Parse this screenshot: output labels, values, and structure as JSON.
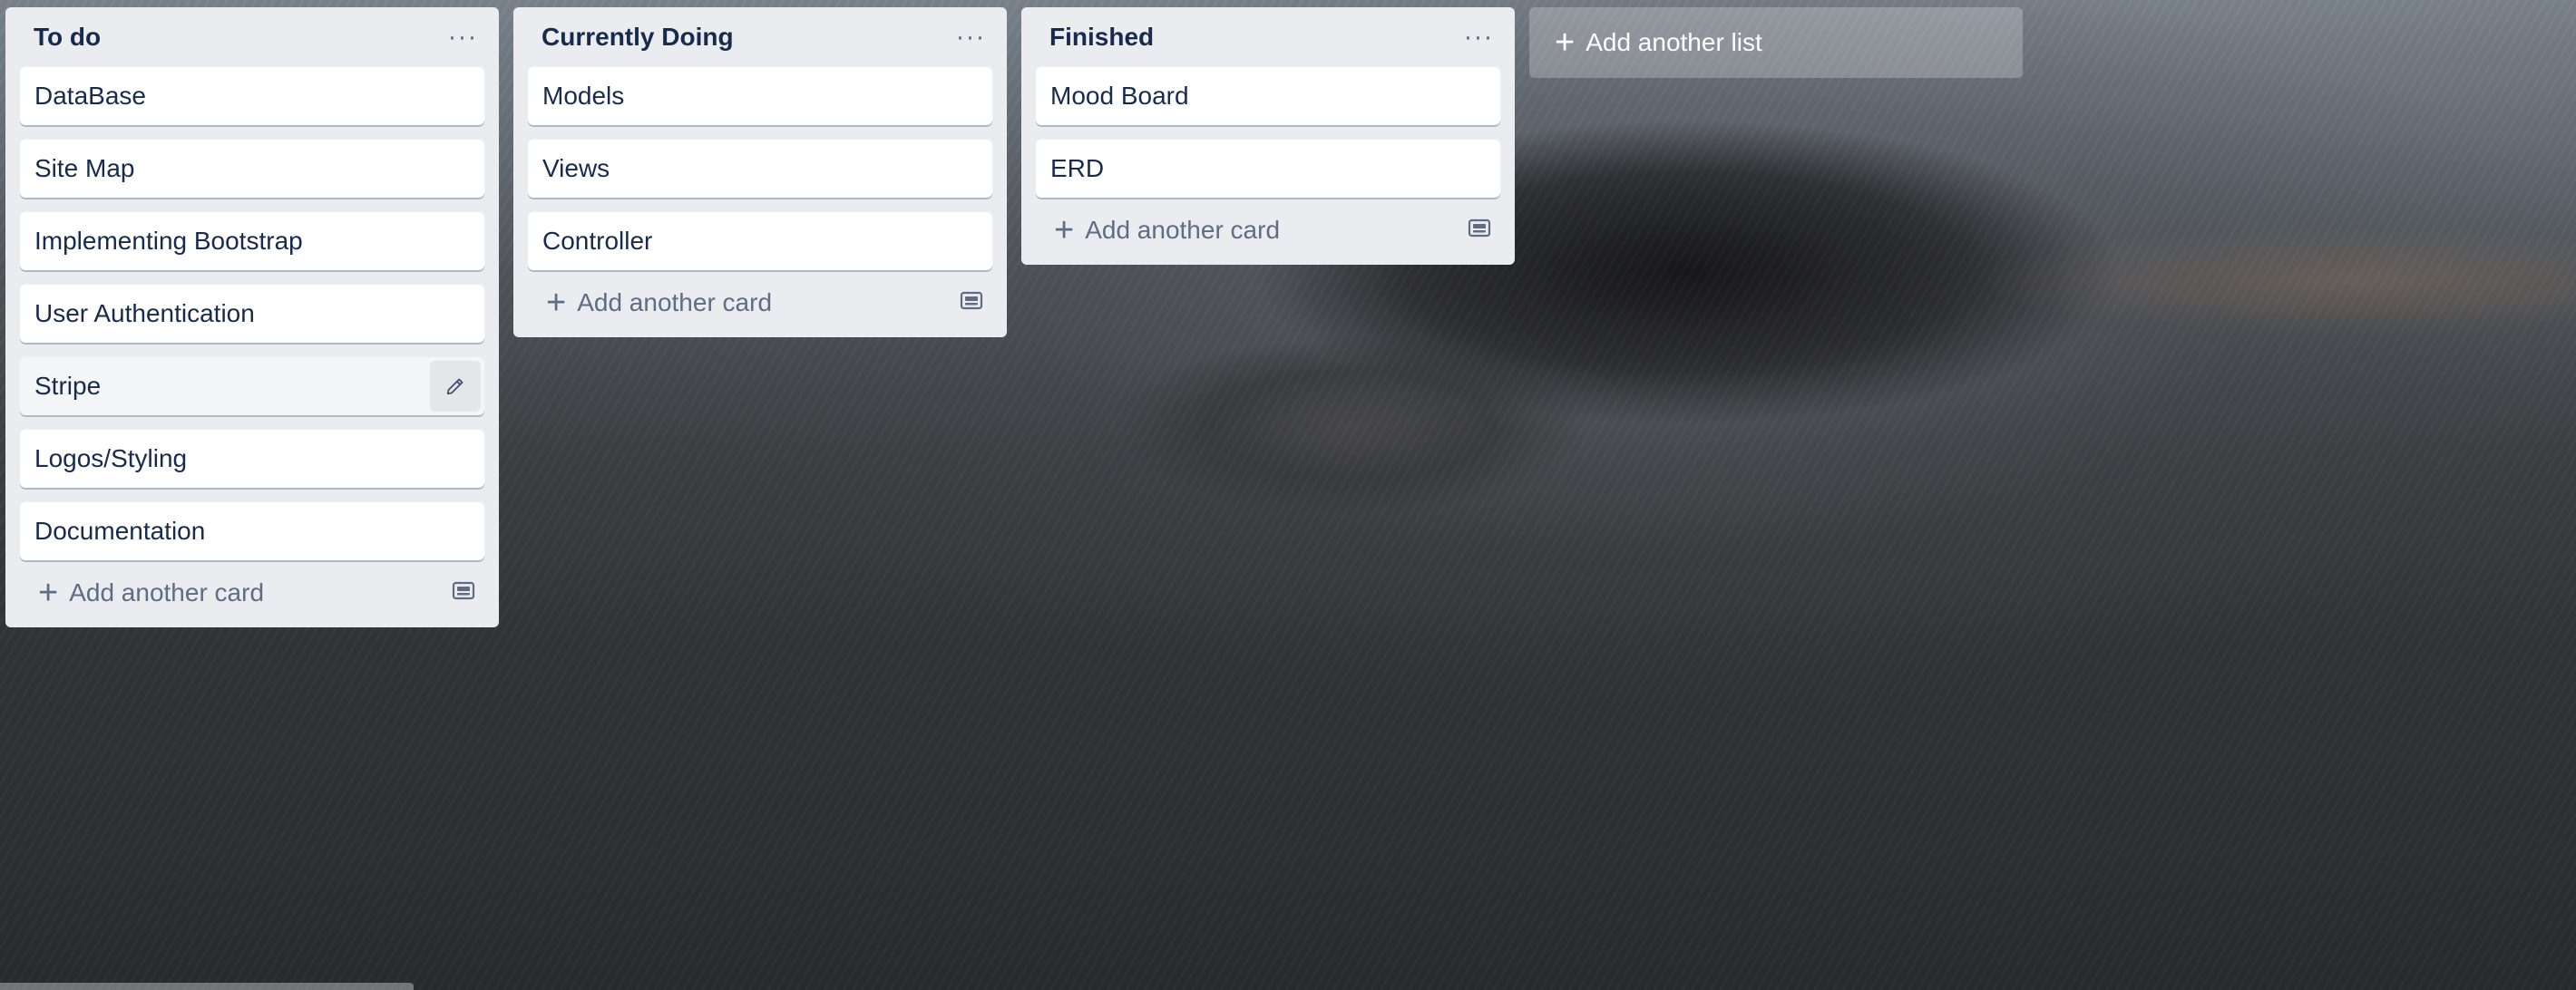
{
  "colors": {
    "list_bg": "#ebecf0",
    "card_bg": "#ffffff",
    "text": "#172b4d",
    "muted": "#5e6c84"
  },
  "lists": [
    {
      "title": "To do",
      "menu_icon": "ellipsis-icon",
      "cards": [
        "DataBase",
        "Site Map",
        "Implementing Bootstrap",
        "User Authentication",
        "Stripe",
        "Logos/Styling",
        "Documentation"
      ],
      "hovered_card": "Stripe",
      "add_card_label": "Add another card",
      "template_icon": "card-template-icon"
    },
    {
      "title": "Currently Doing",
      "menu_icon": "ellipsis-icon",
      "cards": [
        "Models",
        "Views",
        "Controller"
      ],
      "add_card_label": "Add another card",
      "template_icon": "card-template-icon"
    },
    {
      "title": "Finished",
      "menu_icon": "ellipsis-icon",
      "cards": [
        "Mood Board",
        "ERD"
      ],
      "add_card_label": "Add another card",
      "template_icon": "card-template-icon"
    }
  ],
  "add_list": {
    "label": "Add another list",
    "icon": "plus-icon"
  }
}
